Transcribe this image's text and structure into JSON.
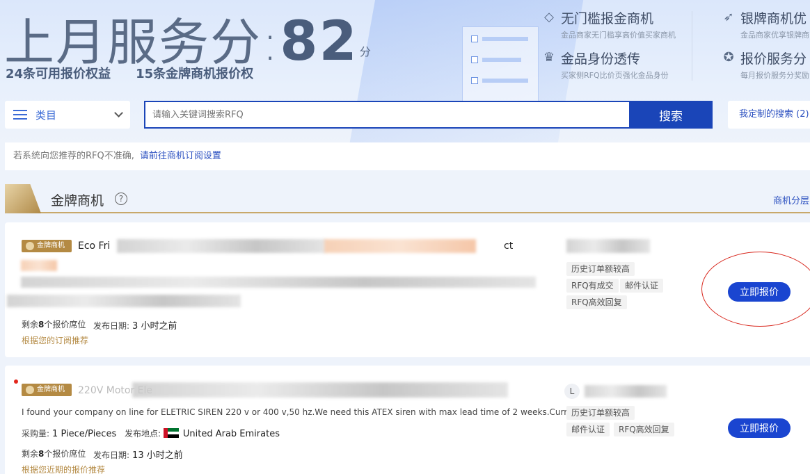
{
  "hero": {
    "title_prefix": "上月服务分",
    "colon": ":",
    "score": "82",
    "unit": "分",
    "rights": [
      "24条可用报价权益",
      "15条金牌商机报价权"
    ],
    "features": [
      {
        "icon": "diamond-icon",
        "title": "无门槛报金商机",
        "desc": "金品商家无门槛享高价值买家商机"
      },
      {
        "icon": "rocket-icon",
        "title": "银牌商机优",
        "desc": "金品商家优享银牌商"
      },
      {
        "icon": "crown-icon",
        "title": "金品身份透传",
        "desc": "买家侧RFQ比价页强化金品身份"
      },
      {
        "icon": "award-icon",
        "title": "报价服务分",
        "desc": "每月报价服务分奖励"
      }
    ]
  },
  "search": {
    "category_label": "类目",
    "placeholder": "请输入关键词搜索RFQ",
    "button": "搜索",
    "custom_search": "我定制的搜索 (2)"
  },
  "notice": {
    "text": "若系统向您推荐的RFQ不准确,",
    "link": "请前往商机订阅设置"
  },
  "section": {
    "title": "金牌商机",
    "help": "?",
    "link": "商机分层"
  },
  "cards": [
    {
      "badge": "金牌商机",
      "title": "Eco Fri",
      "title_tail": "ct",
      "seats_prefix": "剩余",
      "seats_count": "8",
      "seats_suffix": "个报价席位",
      "date_label": "发布日期:",
      "date_value": "3 小时之前",
      "reco": "根据您的订阅推荐",
      "tags": [
        "历史订单额较高",
        "RFQ有成交",
        "邮件认证",
        "RFQ高效回复"
      ],
      "button": "立即报价"
    },
    {
      "badge": "金牌商机",
      "title": "220V Motor Ele",
      "desc": "I found your company on line for ELETRIC SIREN 220 v or 400 v,50 hz.We need this ATEX siren with max lead time of 2 weeks.Curr...",
      "qty_label": "采购量:",
      "qty_value": "1 Piece/Pieces",
      "origin_label": "发布地点:",
      "origin_value": "United Arab Emirates",
      "avatar": "L",
      "seats_prefix": "剩余",
      "seats_count": "8",
      "seats_suffix": "个报价席位",
      "date_label": "发布日期:",
      "date_value": "13 小时之前",
      "reco": "根据您近期的报价推荐",
      "tags": [
        "历史订单额较高",
        "邮件认证",
        "RFQ高效回复"
      ],
      "button": "立即报价"
    }
  ],
  "colors": {
    "primary": "#1a45b8",
    "button": "#1a45d0",
    "gold": "#b48a43",
    "highlight_circle": "#d8261c"
  }
}
